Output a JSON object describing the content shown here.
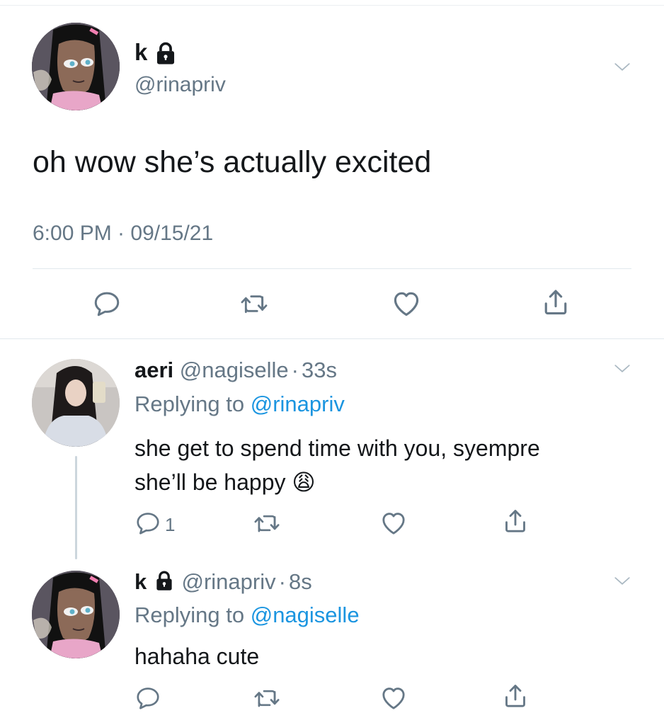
{
  "main_tweet": {
    "display_name": "k",
    "handle": "@rinapriv",
    "text": "oh wow she’s actually excited",
    "timestamp": "6:00 PM · 09/15/21"
  },
  "replies": [
    {
      "display_name": "aeri",
      "handle": "@nagiselle",
      "separator": "·",
      "time_ago": "33s",
      "replying_prefix": "Replying to",
      "replying_to": "@rinapriv",
      "text_line1": "she get to spend time with you, syempre",
      "text_line2": "she’ll be happy",
      "emoji": "😩",
      "reply_count": "1"
    },
    {
      "display_name": "k",
      "handle": "@rinapriv",
      "separator": "·",
      "time_ago": "8s",
      "replying_prefix": "Replying to",
      "replying_to": "@nagiselle",
      "text": "hahaha cute"
    }
  ],
  "colors": {
    "text": "#14171a",
    "secondary": "#657786",
    "link": "#1b95e0",
    "divider": "#e1e8ed"
  },
  "icons": [
    "lock-icon",
    "chevron-down-icon",
    "reply-icon",
    "retweet-icon",
    "like-icon",
    "share-icon"
  ]
}
